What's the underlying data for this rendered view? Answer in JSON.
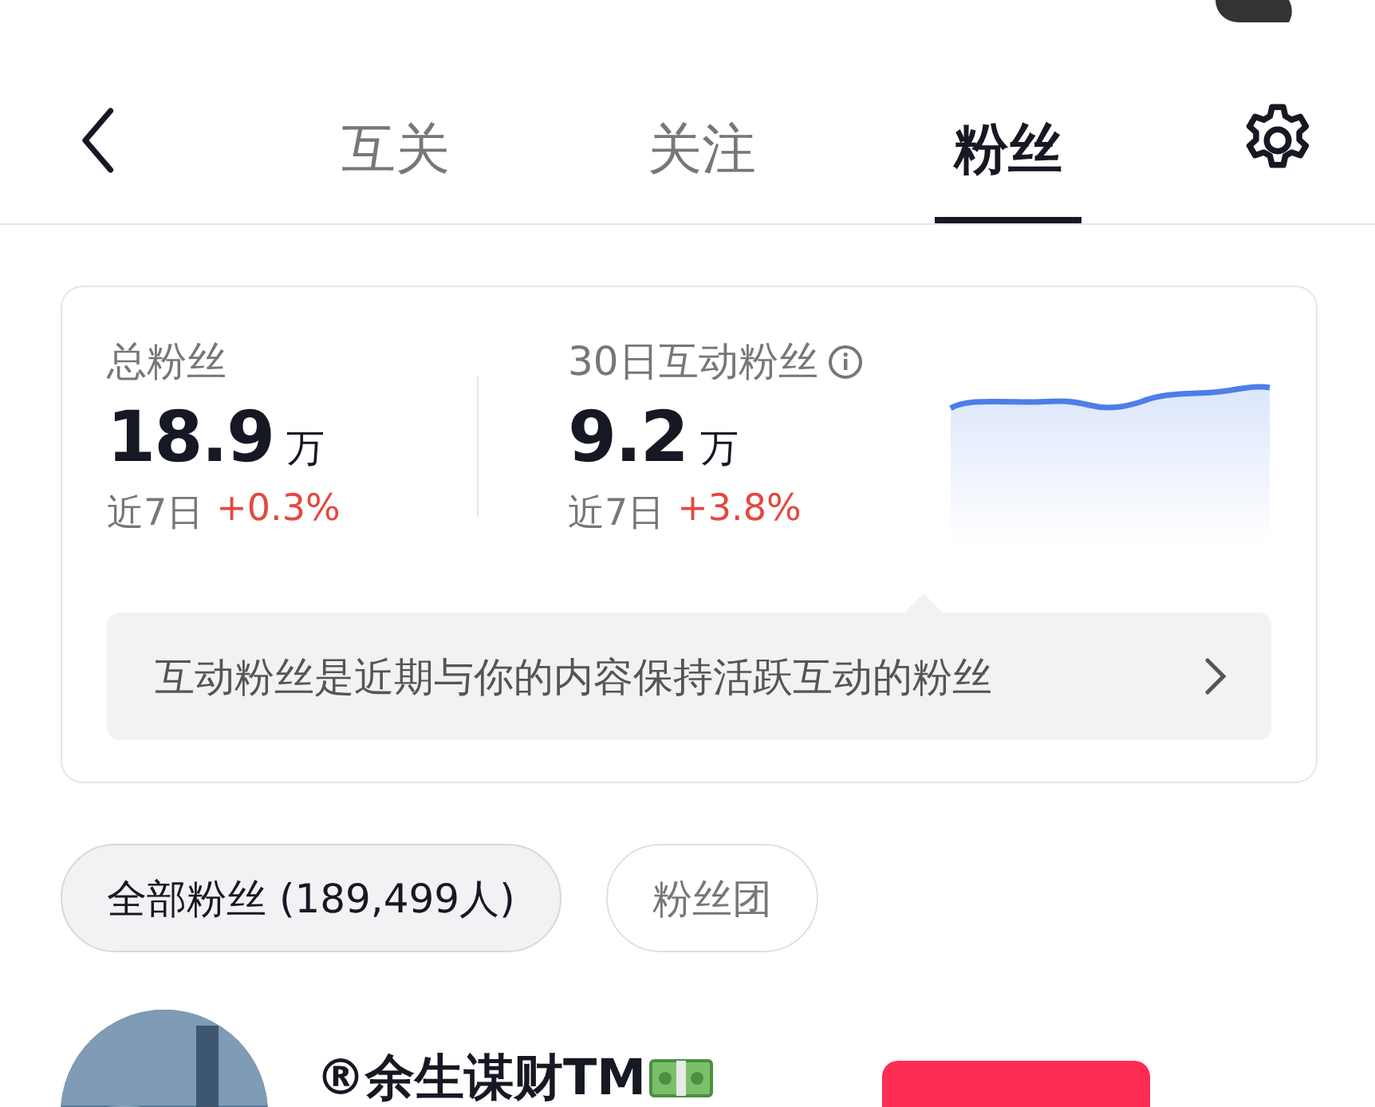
{
  "tabs": [
    {
      "label": "互关",
      "selected": false
    },
    {
      "label": "关注",
      "selected": false
    },
    {
      "label": "粉丝",
      "selected": true
    }
  ],
  "stats": [
    {
      "label": "总粉丝",
      "value": "18.9",
      "unit": "万",
      "period": "近7日",
      "change": "+0.3%",
      "info": false
    },
    {
      "label": "30日互动粉丝",
      "value": "9.2",
      "unit": "万",
      "period": "近7日",
      "change": "+3.8%",
      "info": true
    }
  ],
  "tip": {
    "text": "互动粉丝是近期与你的内容保持活跃互动的粉丝"
  },
  "filters": [
    {
      "label": "全部粉丝 (189,499人)",
      "selected": true
    },
    {
      "label": "粉丝团",
      "selected": false
    }
  ],
  "followers": [
    {
      "name": "®余生谋财TM"
    }
  ]
}
